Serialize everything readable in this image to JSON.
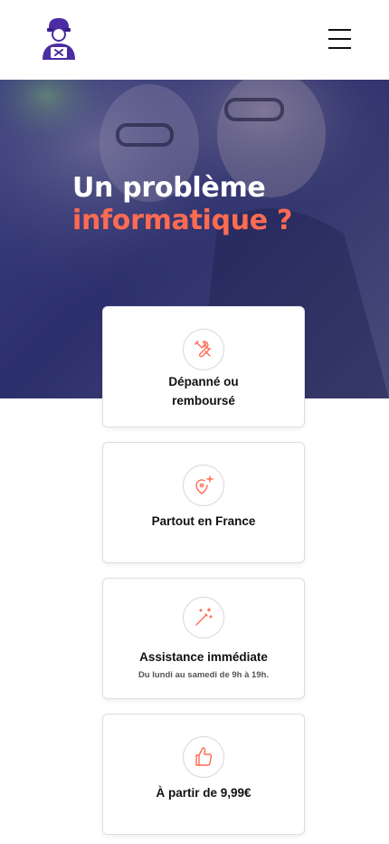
{
  "header": {
    "logo_icon": "technician-logo-icon",
    "menu_icon": "hamburger-menu-icon"
  },
  "hero": {
    "title_line1": "Un problème",
    "title_line2": "informatique ?"
  },
  "colors": {
    "accent": "#ff6b52",
    "brand_purple": "#4b2ca3",
    "hero_overlay": "#2c2f6b"
  },
  "features": [
    {
      "icon": "tools-icon",
      "title_line1": "Dépanné ou",
      "title_line2": "remboursé",
      "subtitle": ""
    },
    {
      "icon": "map-pin-plus-icon",
      "title_line1": "Partout en France",
      "title_line2": "",
      "subtitle": ""
    },
    {
      "icon": "magic-wand-icon",
      "title_line1": "Assistance immédiate",
      "title_line2": "",
      "subtitle": "Du lundi au samedi de 9h à 19h."
    },
    {
      "icon": "thumbs-up-icon",
      "title_line1": "À partir de 9,99€",
      "title_line2": "",
      "subtitle": ""
    }
  ]
}
